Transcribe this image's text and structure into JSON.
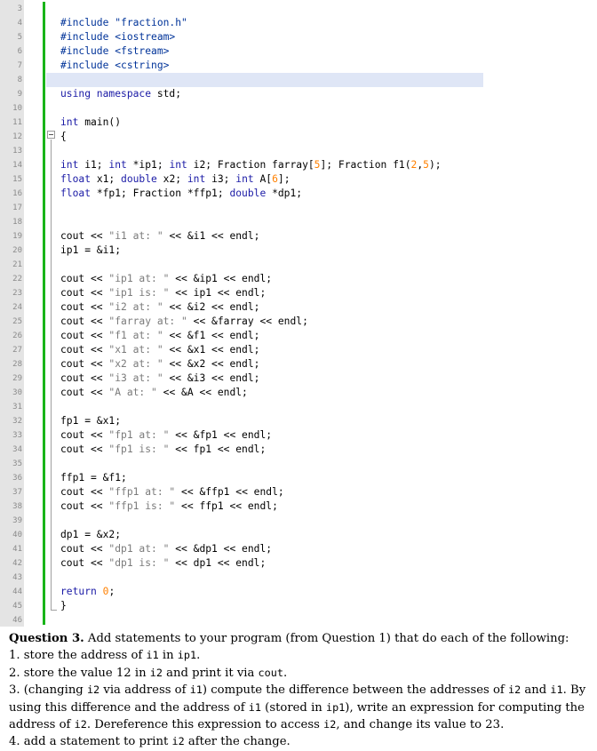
{
  "editor": {
    "lines": [
      {
        "num": "3",
        "html": ""
      },
      {
        "num": "4",
        "html": "<span class=\"pp\">#include \"fraction.h\"</span>"
      },
      {
        "num": "5",
        "html": "<span class=\"pp\">#include &lt;iostream&gt;</span>"
      },
      {
        "num": "6",
        "html": "<span class=\"pp\">#include &lt;fstream&gt;</span>"
      },
      {
        "num": "7",
        "html": "<span class=\"pp\">#include &lt;cstring&gt;</span>"
      },
      {
        "num": "8",
        "html": "",
        "highlight": true
      },
      {
        "num": "9",
        "html": "<span class=\"kw\">using namespace</span> std;"
      },
      {
        "num": "10",
        "html": ""
      },
      {
        "num": "11",
        "html": "<span class=\"kw\">int</span> main()"
      },
      {
        "num": "12",
        "html": "{"
      },
      {
        "num": "13",
        "html": ""
      },
      {
        "num": "14",
        "html": "<span class=\"kw\">int</span> i1; <span class=\"kw\">int</span> *ip1; <span class=\"kw\">int</span> i2; Fraction farray[<span class=\"nm\">5</span>]; Fraction f1(<span class=\"nm\">2</span>,<span class=\"nm\">5</span>);"
      },
      {
        "num": "15",
        "html": "<span class=\"kw\">float</span> x1; <span class=\"kw\">double</span> x2; <span class=\"kw\">int</span> i3; <span class=\"kw\">int</span> A[<span class=\"nm\">6</span>];"
      },
      {
        "num": "16",
        "html": "<span class=\"kw\">float</span> *fp1; Fraction *ffp1; <span class=\"kw\">double</span> *dp1;"
      },
      {
        "num": "17",
        "html": ""
      },
      {
        "num": "18",
        "html": ""
      },
      {
        "num": "19",
        "html": "cout &lt;&lt; <span class=\"st\">\"i1 at: \"</span> &lt;&lt; &amp;i1 &lt;&lt; endl;"
      },
      {
        "num": "20",
        "html": "ip1 = &amp;i1;"
      },
      {
        "num": "21",
        "html": ""
      },
      {
        "num": "22",
        "html": "cout &lt;&lt; <span class=\"st\">\"ip1 at: \"</span> &lt;&lt; &amp;ip1 &lt;&lt; endl;"
      },
      {
        "num": "23",
        "html": "cout &lt;&lt; <span class=\"st\">\"ip1 is: \"</span> &lt;&lt; ip1 &lt;&lt; endl;"
      },
      {
        "num": "24",
        "html": "cout &lt;&lt; <span class=\"st\">\"i2 at: \"</span> &lt;&lt; &amp;i2 &lt;&lt; endl;"
      },
      {
        "num": "25",
        "html": "cout &lt;&lt; <span class=\"st\">\"farray at: \"</span> &lt;&lt; &amp;farray &lt;&lt; endl;"
      },
      {
        "num": "26",
        "html": "cout &lt;&lt; <span class=\"st\">\"f1 at: \"</span> &lt;&lt; &amp;f1 &lt;&lt; endl;"
      },
      {
        "num": "27",
        "html": "cout &lt;&lt; <span class=\"st\">\"x1 at: \"</span> &lt;&lt; &amp;x1 &lt;&lt; endl;"
      },
      {
        "num": "28",
        "html": "cout &lt;&lt; <span class=\"st\">\"x2 at: \"</span> &lt;&lt; &amp;x2 &lt;&lt; endl;"
      },
      {
        "num": "29",
        "html": "cout &lt;&lt; <span class=\"st\">\"i3 at: \"</span> &lt;&lt; &amp;i3 &lt;&lt; endl;"
      },
      {
        "num": "30",
        "html": "cout &lt;&lt; <span class=\"st\">\"A at: \"</span> &lt;&lt; &amp;A &lt;&lt; endl;"
      },
      {
        "num": "31",
        "html": ""
      },
      {
        "num": "32",
        "html": "fp1 = &amp;x1;"
      },
      {
        "num": "33",
        "html": "cout &lt;&lt; <span class=\"st\">\"fp1 at: \"</span> &lt;&lt; &amp;fp1 &lt;&lt; endl;"
      },
      {
        "num": "34",
        "html": "cout &lt;&lt; <span class=\"st\">\"fp1 is: \"</span> &lt;&lt; fp1 &lt;&lt; endl;"
      },
      {
        "num": "35",
        "html": ""
      },
      {
        "num": "36",
        "html": "ffp1 = &amp;f1;"
      },
      {
        "num": "37",
        "html": "cout &lt;&lt; <span class=\"st\">\"ffp1 at: \"</span> &lt;&lt; &amp;ffp1 &lt;&lt; endl;"
      },
      {
        "num": "38",
        "html": "cout &lt;&lt; <span class=\"st\">\"ffp1 is: \"</span> &lt;&lt; ffp1 &lt;&lt; endl;"
      },
      {
        "num": "39",
        "html": ""
      },
      {
        "num": "40",
        "html": "dp1 = &amp;x2;"
      },
      {
        "num": "41",
        "html": "cout &lt;&lt; <span class=\"st\">\"dp1 at: \"</span> &lt;&lt; &amp;dp1 &lt;&lt; endl;"
      },
      {
        "num": "42",
        "html": "cout &lt;&lt; <span class=\"st\">\"dp1 is: \"</span> &lt;&lt; dp1 &lt;&lt; endl;"
      },
      {
        "num": "43",
        "html": ""
      },
      {
        "num": "44",
        "html": "<span class=\"kw\">return</span> <span class=\"nm\">0</span>;"
      },
      {
        "num": "45",
        "html": "}"
      },
      {
        "num": "46",
        "html": ""
      }
    ]
  },
  "question": {
    "heading": "Question 3.",
    "intro": " Add statements to your program (from Question 1) that do each of the following:",
    "items": [
      "1. store the address of <span class=\"mono\">i1</span> in <span class=\"mono\">ip1</span>.",
      "2. store the value 12 in <span class=\"mono\">i2</span> and print it via <span class=\"mono\">cout</span>.",
      "3. (changing <span class=\"mono\">i2</span> via address of <span class=\"mono\">i1</span>) compute the difference between the addresses of <span class=\"mono\">i2</span> and <span class=\"mono\">i1</span>. By using this difference and the address of <span class=\"mono\">i1</span> (stored in <span class=\"mono\">ip1</span>), write an expression for computing the address of <span class=\"mono\">i2</span>. Dereference this expression to access <span class=\"mono\">i2</span>, and change its value to 23.",
      "4. add a statement to print <span class=\"mono\">i2</span> after the change."
    ]
  }
}
